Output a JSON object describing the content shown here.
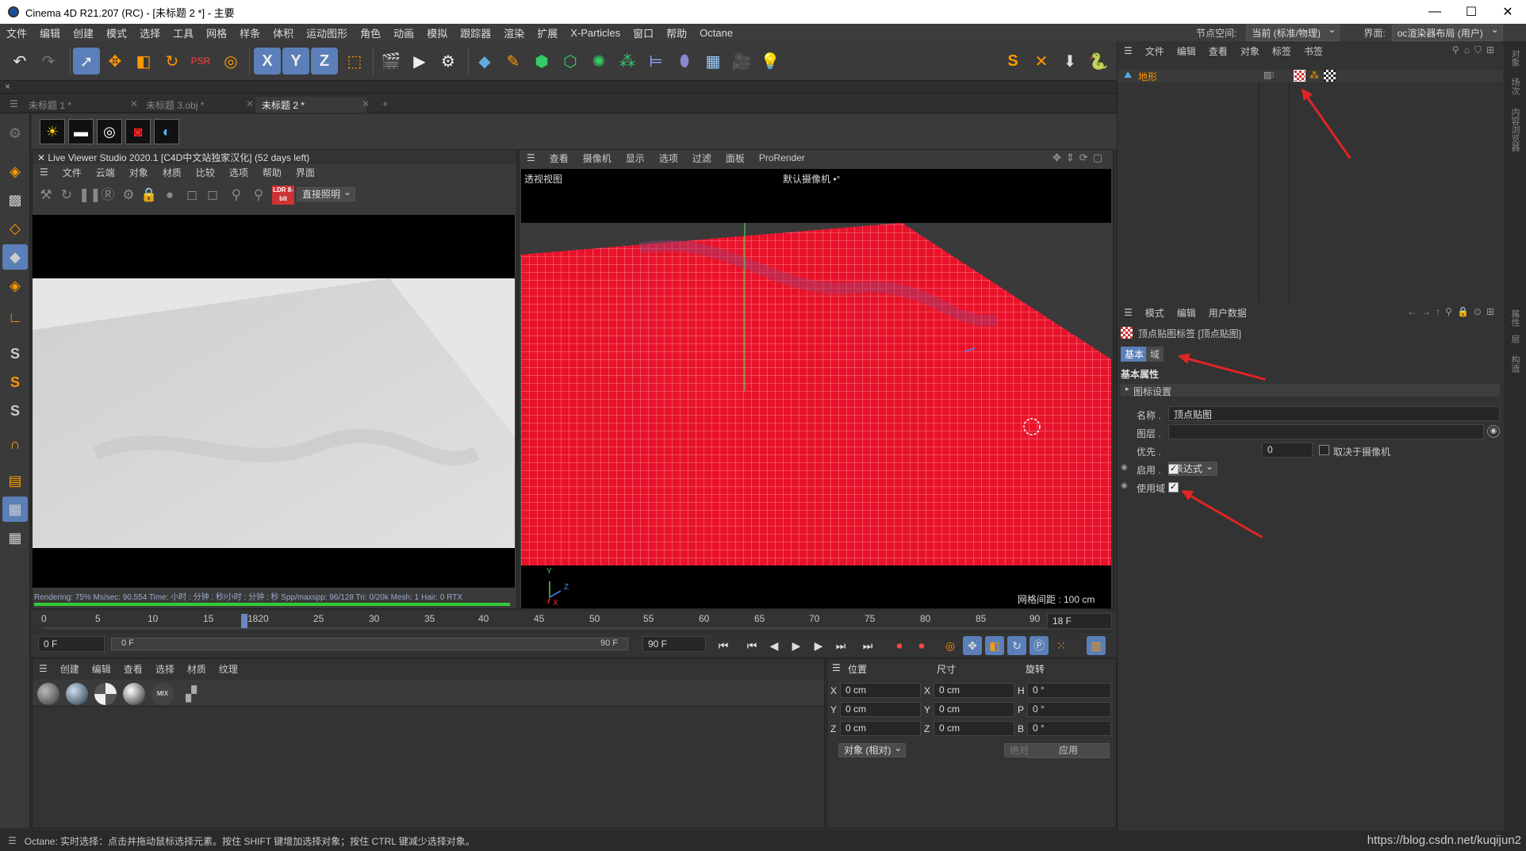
{
  "titlebar": {
    "title": "Cinema 4D R21.207 (RC) - [未标题 2 *] - 主要",
    "min": "—",
    "max": "☐",
    "close": "✕"
  },
  "menubar": {
    "items": [
      "文件",
      "编辑",
      "创建",
      "模式",
      "选择",
      "工具",
      "网格",
      "样条",
      "体积",
      "运动图形",
      "角色",
      "动画",
      "模拟",
      "跟踪器",
      "渲染",
      "扩展",
      "X-Particles",
      "窗口",
      "帮助",
      "Octane"
    ],
    "node_space_label": "节点空间:",
    "node_space_value": "当前 (标准/物理)",
    "layout_label": "界面:",
    "layout_value": "oc渲染器布局 (用户)"
  },
  "close_row": "×",
  "tabs": {
    "items": [
      "未标题 1 *",
      "未标题 3.obj *",
      "未标题 2 *"
    ],
    "add": "+"
  },
  "axis": {
    "x": "X",
    "y": "Y",
    "z": "Z"
  },
  "liveviewer": {
    "title": "Live Viewer Studio 2020.1 [C4D中文站独家汉化] (52 days left)",
    "menu": [
      "文件",
      "云端",
      "对象",
      "材质",
      "比较",
      "选项",
      "帮助",
      "界面"
    ],
    "ldr": "LDR 8-bit",
    "mode": "直接照明",
    "status": "Rendering: 75%  Ms/sec: 90.554   Time: 小时 : 分钟 : 秒/小时 : 分钟 : 秒   Spp/maxspp: 96/128   Tri: 0/20k   Mesh: 1    Hair: 0   RTX"
  },
  "viewport": {
    "menu": [
      "查看",
      "摄像机",
      "显示",
      "选项",
      "过滤",
      "面板",
      "ProRender"
    ],
    "view_name": "透视视图",
    "camera": "默认摄像机 •°",
    "grid": "网格间距 : 100 cm",
    "axis_y": "Y",
    "axis_z": "Z",
    "axis_x": "X"
  },
  "timeline": {
    "ticks": [
      "0",
      "5",
      "10",
      "15",
      "1820",
      "25",
      "30",
      "35",
      "40",
      "45",
      "50",
      "55",
      "60",
      "65",
      "70",
      "75",
      "80",
      "85",
      "90"
    ],
    "current": "18 F"
  },
  "transport": {
    "start": "0 F",
    "range_start": "0 F",
    "range_end": "90 F",
    "end": "90 F"
  },
  "material": {
    "menu": [
      "创建",
      "编辑",
      "查看",
      "选择",
      "材质",
      "纹理"
    ]
  },
  "coords": {
    "headers": [
      "位置",
      "尺寸",
      "旋转"
    ],
    "rows": [
      {
        "a": "X",
        "p": "0 cm",
        "b": "X",
        "s": "0 cm",
        "c": "H",
        "r": "0 °"
      },
      {
        "a": "Y",
        "p": "0 cm",
        "b": "Y",
        "s": "0 cm",
        "c": "P",
        "r": "0 °"
      },
      {
        "a": "Z",
        "p": "0 cm",
        "b": "Z",
        "s": "0 cm",
        "c": "B",
        "r": "0 °"
      }
    ],
    "mode": "对象 (相对)",
    "size_mode": "绝对尺寸",
    "apply": "应用"
  },
  "objmgr": {
    "menu": [
      "文件",
      "编辑",
      "查看",
      "对象",
      "标签",
      "书签"
    ],
    "object": "地形"
  },
  "attrmgr": {
    "menu": [
      "模式",
      "编辑",
      "用户数据"
    ],
    "tag_title": "顶点贴图标签 [顶点贴图]",
    "tabs": [
      "基本",
      "域"
    ],
    "section": "基本属性",
    "group": "图标设置",
    "name_label": "名称 .",
    "name_value": "顶点贴图",
    "layer_label": "图层 .",
    "prio_label": "优先 .",
    "prio_value": "表达式",
    "prio_num": "0",
    "camera_dep": "取决于摄像机",
    "enable_label": "启用 .",
    "usefield_label": "使用域"
  },
  "sidetabs": [
    "对象",
    "场次",
    "内容浏览器",
    "属性",
    "层",
    "构造"
  ],
  "statusbar": {
    "text": "Octane:   实时选择：点击并拖动鼠标选择元素。按住 SHIFT 键增加选择对象；按住 CTRL 键减少选择对象。",
    "watermark": "https://blog.csdn.net/kuqijun2"
  },
  "colors": {
    "accent": "#5b7fb8",
    "mesh": "#e8132b",
    "annotation": "#e02525",
    "live_progress": "#33cc33"
  }
}
